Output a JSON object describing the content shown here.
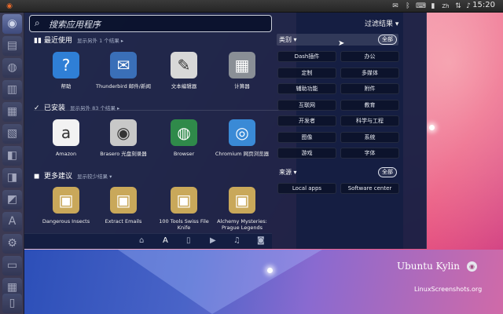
{
  "clock": "15:20",
  "topbar": {
    "icons": [
      "mail-icon",
      "bluetooth-icon",
      "keyboard-icon",
      "battery-icon",
      "chat-icon",
      "network-icon",
      "volume-icon"
    ],
    "kb_label": "Zh"
  },
  "search": {
    "placeholder": "搜索应用程序"
  },
  "filter_label": "过滤结果 ▾",
  "sections": {
    "recent": {
      "title": "最近使用",
      "sub": "显示另外 1 个结果 ▸"
    },
    "installed": {
      "title": "已安装",
      "sub": "显示另外 83 个结果 ▸"
    },
    "more": {
      "title": "更多建议",
      "sub": "显示较少结果 ▾"
    }
  },
  "recent_apps": [
    {
      "label": "帮助",
      "icon": "help-icon",
      "glyph": "?",
      "color": "#2f7fd6"
    },
    {
      "label": "Thunderbird 邮件/新闻",
      "icon": "thunderbird-icon",
      "glyph": "✉",
      "color": "#3a6fb8"
    },
    {
      "label": "文本编辑器",
      "icon": "text-editor-icon",
      "glyph": "✎",
      "color": "#d8d8d8"
    },
    {
      "label": "计算器",
      "icon": "calculator-icon",
      "glyph": "▦",
      "color": "#8a8f96"
    }
  ],
  "installed_apps": [
    {
      "label": "Amazon",
      "icon": "amazon-icon",
      "glyph": "a",
      "color": "#f2f2f2"
    },
    {
      "label": "Brasero 光盘刻录器",
      "icon": "brasero-icon",
      "glyph": "◉",
      "color": "#c8c8c8"
    },
    {
      "label": "Browser",
      "icon": "browser-globe-icon",
      "glyph": "◍",
      "color": "#2f8a4a"
    },
    {
      "label": "Chromium 网页浏览器",
      "icon": "chromium-icon",
      "glyph": "◎",
      "color": "#3a8ad6"
    }
  ],
  "suggested_apps": [
    {
      "label": "Dangerous Insects",
      "icon": "software-box-icon",
      "glyph": "▣",
      "color": "#c9a85a"
    },
    {
      "label": "Extract Emails",
      "icon": "software-box-icon",
      "glyph": "▣",
      "color": "#c9a85a"
    },
    {
      "label": "100 Tools Swiss File Knife",
      "icon": "software-box-icon",
      "glyph": "▣",
      "color": "#c9a85a"
    },
    {
      "label": "Alchemy Mysteries: Prague Legends",
      "icon": "software-box-icon",
      "glyph": "▣",
      "color": "#c9a85a"
    }
  ],
  "categories": {
    "title": "类别 ▾",
    "all_label": "全部",
    "items": [
      "Dash插件",
      "办公",
      "定制",
      "多媒体",
      "辅助功能",
      "附件",
      "互联网",
      "教育",
      "开发者",
      "科学与工程",
      "图像",
      "系统",
      "游戏",
      "字体"
    ]
  },
  "sources": {
    "title": "来源 ▾",
    "all_label": "全部",
    "items": [
      "Local apps",
      "Software center"
    ]
  },
  "lens_bar": [
    "home-lens-icon",
    "apps-lens-icon",
    "files-lens-icon",
    "video-lens-icon",
    "music-lens-icon",
    "photo-lens-icon"
  ],
  "branding": {
    "name": "Ubuntu Kylin",
    "watermark": "LinuxScreenshots.org"
  }
}
